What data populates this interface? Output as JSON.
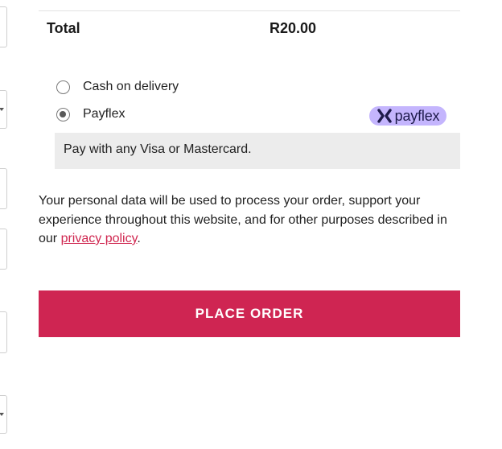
{
  "order_summary": {
    "total_label": "Total",
    "total_value": "R20.00"
  },
  "payment": {
    "options": [
      {
        "label": "Cash on delivery",
        "selected": false
      },
      {
        "label": "Payflex",
        "selected": true,
        "logo_text": "payflex",
        "logo_icon": "payflex-x-icon"
      }
    ],
    "selected_description": "Pay with any Visa or Mastercard."
  },
  "privacy": {
    "text_before": "Your personal data will be used to process your order, support your experience throughout this website, and for other purposes described in our ",
    "link_label": "privacy policy",
    "text_after": "."
  },
  "actions": {
    "place_order_label": "PLACE ORDER"
  },
  "colors": {
    "accent": "#cf2552",
    "payflex_badge": "#c4b5fd",
    "description_box": "#ececec"
  }
}
